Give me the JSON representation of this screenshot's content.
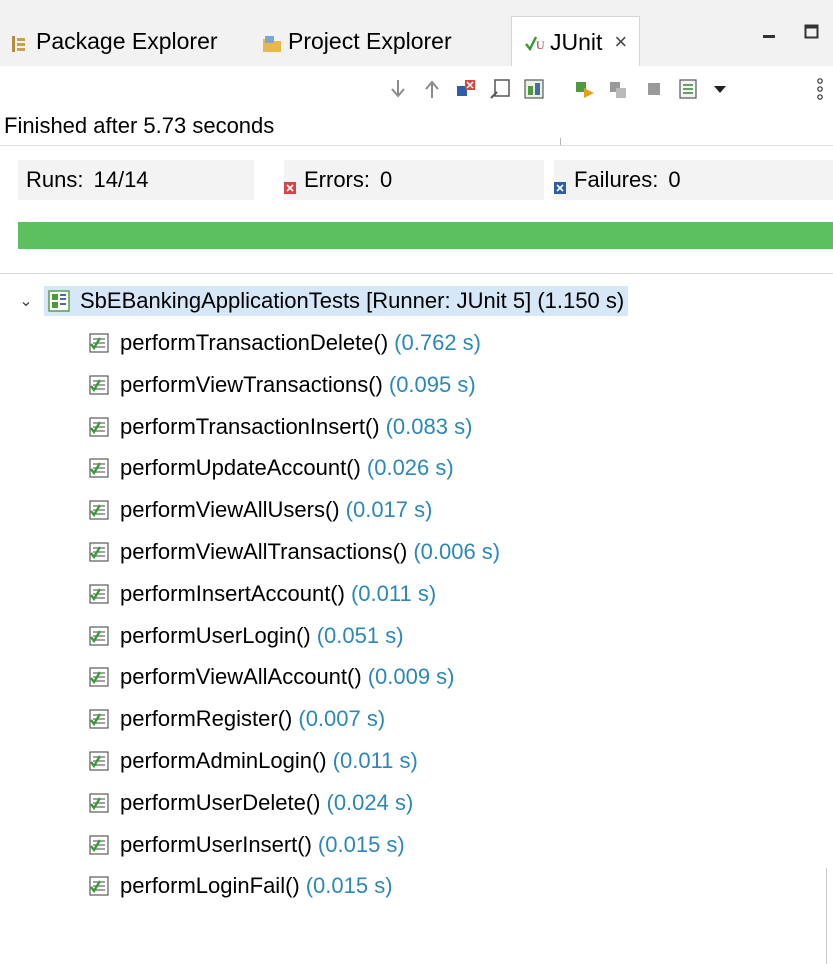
{
  "tabs": [
    {
      "label": "Package Explorer",
      "icon": "package-explorer-icon",
      "active": false
    },
    {
      "label": "Project Explorer",
      "icon": "project-explorer-icon",
      "active": false
    },
    {
      "label": "JUnit",
      "icon": "junit-icon",
      "active": true
    }
  ],
  "status": {
    "finished": "Finished after 5.73 seconds"
  },
  "counters": {
    "runs_label": "Runs:",
    "runs_value": "14/14",
    "errors_label": "Errors:",
    "errors_value": "0",
    "failures_label": "Failures:",
    "failures_value": "0"
  },
  "progress": {
    "fraction": 1.0,
    "color": "#5cc15c"
  },
  "tree": {
    "root": {
      "label": "SbEBankingApplicationTests [Runner: JUnit 5] (1.150 s)"
    },
    "tests": [
      {
        "name": "performTransactionDelete()",
        "time": "(0.762 s)"
      },
      {
        "name": "performViewTransactions()",
        "time": "(0.095 s)"
      },
      {
        "name": "performTransactionInsert()",
        "time": "(0.083 s)"
      },
      {
        "name": "performUpdateAccount()",
        "time": "(0.026 s)"
      },
      {
        "name": "performViewAllUsers()",
        "time": "(0.017 s)"
      },
      {
        "name": "performViewAllTransactions()",
        "time": "(0.006 s)"
      },
      {
        "name": "performInsertAccount()",
        "time": "(0.011 s)"
      },
      {
        "name": "performUserLogin()",
        "time": "(0.051 s)"
      },
      {
        "name": "performViewAllAccount()",
        "time": "(0.009 s)"
      },
      {
        "name": "performRegister()",
        "time": "(0.007 s)"
      },
      {
        "name": "performAdminLogin()",
        "time": "(0.011 s)"
      },
      {
        "name": "performUserDelete()",
        "time": "(0.024 s)"
      },
      {
        "name": "performUserInsert()",
        "time": "(0.015 s)"
      },
      {
        "name": "performLoginFail()",
        "time": "(0.015 s)"
      }
    ]
  },
  "colors": {
    "time": "#2c87b8",
    "selection": "#d6e8f8",
    "error": "#d64545",
    "failure": "#2f5da8"
  }
}
